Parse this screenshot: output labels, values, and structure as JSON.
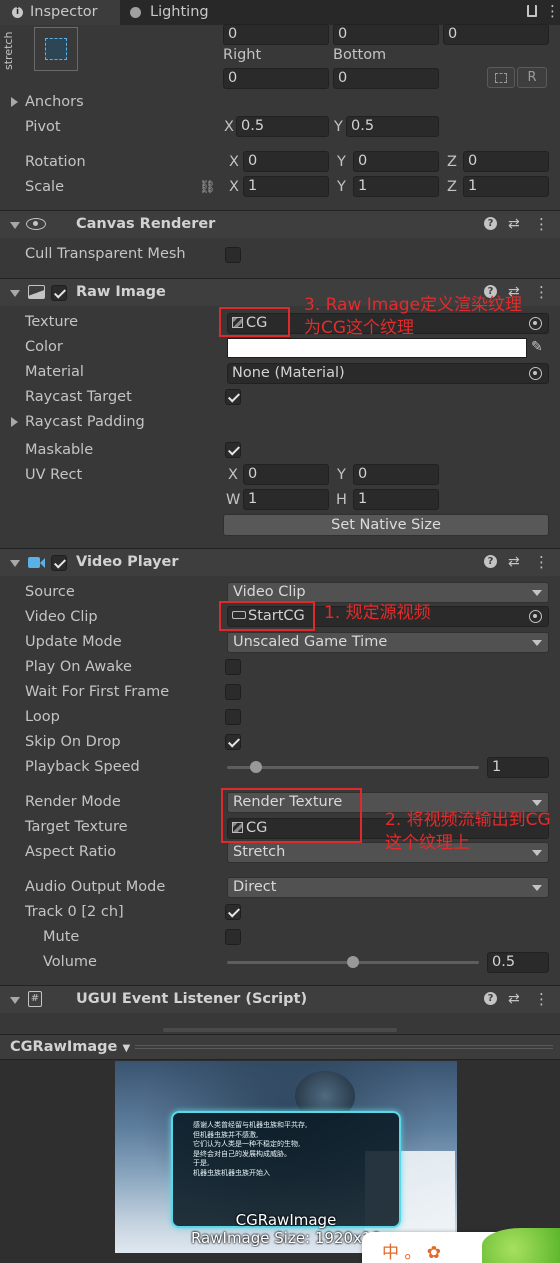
{
  "tabs": {
    "inspector": "Inspector",
    "lighting": "Lighting"
  },
  "rect": {
    "stretch": "stretch",
    "row0": [
      "0",
      "0",
      "0"
    ],
    "right_label": "Right",
    "bottom_label": "Bottom",
    "right_value": "0",
    "bottom_value": "0",
    "r_button": "R",
    "anchors": "Anchors",
    "pivot": {
      "label": "Pivot",
      "x_label": "X",
      "x": "0.5",
      "y_label": "Y",
      "y": "0.5"
    },
    "rotation": {
      "label": "Rotation",
      "x": "0",
      "y": "0",
      "z": "0"
    },
    "scale": {
      "label": "Scale",
      "x": "1",
      "y": "1",
      "z": "1"
    },
    "axis": {
      "x": "X",
      "y": "Y",
      "z": "Z"
    }
  },
  "canvas_renderer": {
    "title": "Canvas Renderer",
    "cull_label": "Cull Transparent Mesh",
    "cull": false
  },
  "raw_image": {
    "title": "Raw Image",
    "texture_label": "Texture",
    "texture": "CG",
    "color_label": "Color",
    "color": "#ffffff",
    "material_label": "Material",
    "material": "None (Material)",
    "raycast_target_label": "Raycast Target",
    "raycast_target": true,
    "raycast_padding_label": "Raycast Padding",
    "maskable_label": "Maskable",
    "maskable": true,
    "uvrect_label": "UV Rect",
    "uv": {
      "x_label": "X",
      "x": "0",
      "y_label": "Y",
      "y": "0",
      "w_label": "W",
      "w": "1",
      "h_label": "H",
      "h": "1"
    },
    "set_native_size": "Set Native Size"
  },
  "video_player": {
    "title": "Video Player",
    "source_label": "Source",
    "source": "Video Clip",
    "video_clip_label": "Video Clip",
    "video_clip": "StartCG",
    "update_mode_label": "Update Mode",
    "update_mode": "Unscaled Game Time",
    "play_on_awake_label": "Play On Awake",
    "play_on_awake": false,
    "wait_first_frame_label": "Wait For First Frame",
    "wait_first_frame": false,
    "loop_label": "Loop",
    "loop": false,
    "skip_on_drop_label": "Skip On Drop",
    "skip_on_drop": true,
    "playback_speed_label": "Playback Speed",
    "playback_speed": "1",
    "render_mode_label": "Render Mode",
    "render_mode": "Render Texture",
    "target_texture_label": "Target Texture",
    "target_texture": "CG",
    "aspect_ratio_label": "Aspect Ratio",
    "aspect_ratio": "Stretch",
    "audio_output_label": "Audio Output Mode",
    "audio_output": "Direct",
    "track_label": "Track 0 [2 ch]",
    "track": true,
    "mute_label": "Mute",
    "mute": false,
    "volume_label": "Volume",
    "volume": "0.5"
  },
  "ugui": {
    "title": "UGUI Event Listener (Script)"
  },
  "preview": {
    "dropdown": "CGRawImage",
    "name": "CGRawImage",
    "size": "RawImage Size: 1920x10",
    "screen_text": [
      "感谢人类曾经留与机器虫族和平共存,",
      "但机器虫族并不感激,",
      "它们认为人类是一种不稳定的生物,",
      "是终会对自己的发展构成威胁。",
      "于是,",
      "机器虫族机器虫族开始入"
    ],
    "badge": "中 。 ✿"
  },
  "annotations": {
    "note1": "1. 规定源视频",
    "note2_line1": "2. 将视频流输出到CG",
    "note2_line2": "这个纹理上",
    "note3_line1": "3. Raw Image定义渲染纹理",
    "note3_line2": "为CG这个纹理"
  },
  "colors": {
    "annotation": "#e0292a",
    "field_bg": "#2a2a2a",
    "panel_bg": "#383838"
  }
}
